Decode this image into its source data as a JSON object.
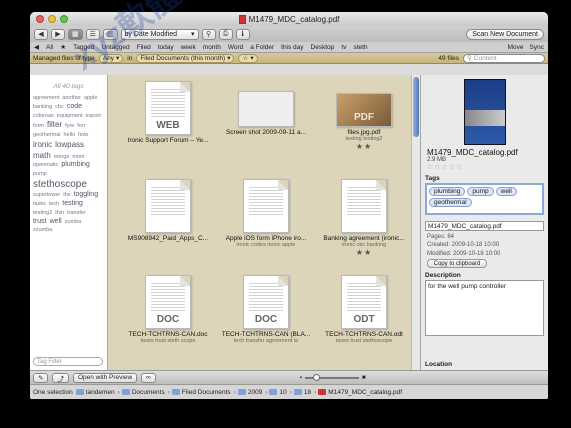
{
  "window": {
    "title": "M1479_MDC_catalog.pdf",
    "traffic_lights": [
      "#ec5f59",
      "#f1bd3b",
      "#5ec84c"
    ]
  },
  "toolbar": {
    "sort_value": "by Date Modified",
    "scan_label": "Scan New Document"
  },
  "favorites": {
    "items": [
      "All",
      "Tagged",
      "Untagged",
      "Filed",
      "today",
      "week",
      "month",
      "Word",
      "a Folder",
      "this day",
      "Desktop",
      "tv",
      "steth"
    ],
    "right": [
      "Move",
      "Sync"
    ]
  },
  "filter": {
    "label": "Managed files of type",
    "type": "Any",
    "in": "in",
    "scope": "Filed Documents (this month)",
    "count": "49 files",
    "search_placeholder": "Content"
  },
  "tagcloud": {
    "title": "All 40 tags",
    "tags": [
      "agreement",
      "another",
      "apple",
      "banking",
      "cbc",
      "code",
      "coloroas",
      "equipment",
      "export",
      "form",
      "filter",
      "fyre",
      "forr",
      "geothermal",
      "hello",
      "how",
      "ironic",
      "lowpass",
      "math",
      "merge",
      "mom",
      "openmatic",
      "plumbing",
      "pump",
      "stethoscope",
      "supertower",
      "thx",
      "toggling",
      "tasks",
      "tech",
      "testing",
      "testing2",
      "thin",
      "transfer",
      "trust",
      "well",
      "zumba",
      "zzumba"
    ],
    "filter_placeholder": "Tag Filter"
  },
  "grid": [
    {
      "name": "Ironic Support Forum – Ye...",
      "tags": "",
      "kind": "WEB",
      "stars": ""
    },
    {
      "name": "Screen shot 2009-09-11 a...",
      "tags": "",
      "kind": "",
      "stars": ""
    },
    {
      "name": "files.jpg.pdf",
      "tags": "testing testing2",
      "kind": "PDF",
      "stars": "★★"
    },
    {
      "name": "MS908942_Paid_Apps_C...",
      "tags": "",
      "kind": "",
      "stars": ""
    },
    {
      "name": "Apple iOS form iPhone iro...",
      "tags": "ironic codes ironic apple",
      "kind": "",
      "stars": ""
    },
    {
      "name": "Banking agreement (ironic...",
      "tags": "ironic cbc banking",
      "kind": "",
      "stars": "★★"
    },
    {
      "name": "TECH-TCHTRNS-CAN.doc",
      "tags": "taxes trust steth scope",
      "kind": "DOC",
      "stars": ""
    },
    {
      "name": "TECH-TCHTRNS-CAN (BLA...",
      "tags": "tech transfer agreement la",
      "kind": "DOC",
      "stars": ""
    },
    {
      "name": "TECH-TCHTRNS-CAN.odt",
      "tags": "taxes trust stethoscope",
      "kind": "ODT",
      "stars": ""
    }
  ],
  "inspector": {
    "title": "M1479_MDC_catalog.pdf",
    "size": "2.9 MB",
    "stars": "☆☆☆☆☆",
    "tags_label": "Tags",
    "tags": [
      "plumbing",
      "pump",
      "well",
      "geothermal"
    ],
    "filename": "M1479_MDC_catalog.pdf",
    "pages": "Pages: 84",
    "created": "Created: 2009-10-18 10:00",
    "modified": "Modified: 2009-10-18 10:00",
    "clip_label": "Copy to clipboard",
    "description_label": "Description",
    "description": "for the well pump controller",
    "location_label": "Location"
  },
  "bottombar": {
    "open_preview": "Open with Preview"
  },
  "status": {
    "selection": "One selection",
    "crumbs": [
      "tandemen",
      "Documents",
      "Filed Documents",
      "2009",
      "10",
      "18",
      "M1479_MDC_catalog.pdf"
    ]
  },
  "watermark": "xyz軟體補給站 http://3c.to"
}
